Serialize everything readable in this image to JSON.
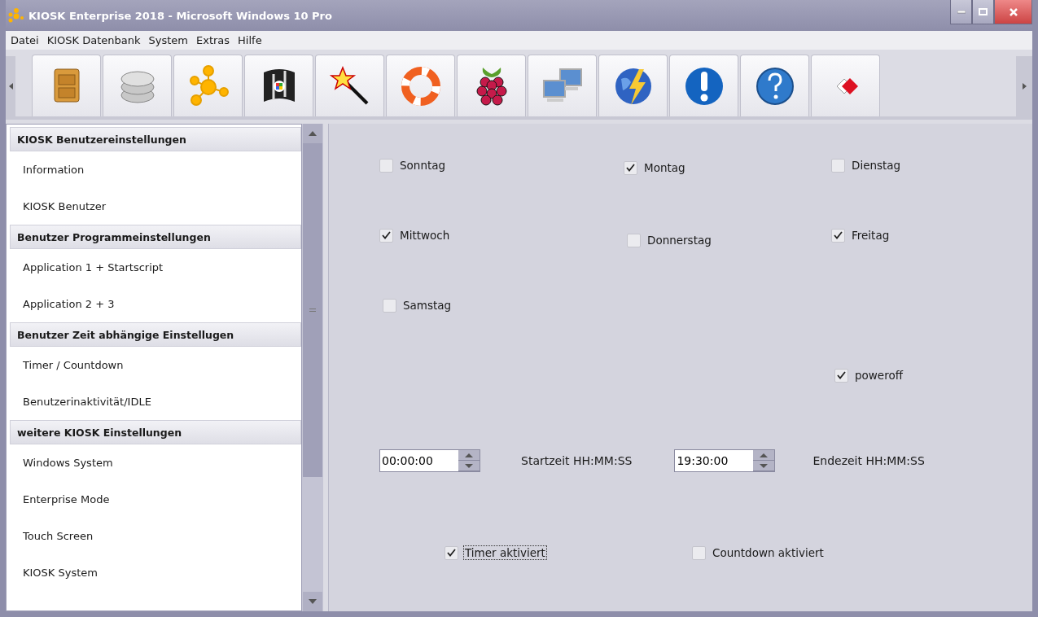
{
  "window": {
    "title": "KIOSK Enterprise 2018 - Microsoft Windows 10 Pro"
  },
  "menu": [
    "Datei",
    "KIOSK Datenbank",
    "System",
    "Extras",
    "Hilfe"
  ],
  "sidebar": {
    "sections": [
      {
        "title": "KIOSK Benutzereinstellungen",
        "items": [
          "Information",
          "KIOSK Benutzer"
        ]
      },
      {
        "title": "Benutzer Programmeinstellungen",
        "items": [
          "Application 1 + Startscript",
          "Application 2 + 3"
        ]
      },
      {
        "title": "Benutzer Zeit abhängige Einstellugen",
        "items": [
          "Timer / Countdown",
          "Benutzerinaktivität/IDLE"
        ]
      },
      {
        "title": "weitere KIOSK Einstellungen",
        "items": [
          "Windows System",
          "Enterprise Mode",
          "Touch Screen",
          "KIOSK System"
        ]
      }
    ]
  },
  "days": [
    {
      "label": "Sonntag",
      "checked": false
    },
    {
      "label": "Montag",
      "checked": true
    },
    {
      "label": "Dienstag",
      "checked": false
    },
    {
      "label": "Mittwoch",
      "checked": true
    },
    {
      "label": "Donnerstag",
      "checked": false
    },
    {
      "label": "Freitag",
      "checked": true
    },
    {
      "label": "Samstag",
      "checked": false
    }
  ],
  "poweroff": {
    "label": "poweroff",
    "checked": true
  },
  "time_row": [
    {
      "kind": "spinner",
      "value": "00:00:00"
    },
    {
      "kind": "label",
      "text": "Startzeit HH:MM:SS"
    },
    {
      "kind": "spinner",
      "value": "19:30:00"
    },
    {
      "kind": "label",
      "text": "Endezeit HH:MM:SS"
    }
  ],
  "activation": [
    {
      "label": "Timer aktiviert",
      "checked": true,
      "focused": true
    },
    {
      "label": "Countdown aktiviert",
      "checked": false,
      "focused": false
    }
  ]
}
